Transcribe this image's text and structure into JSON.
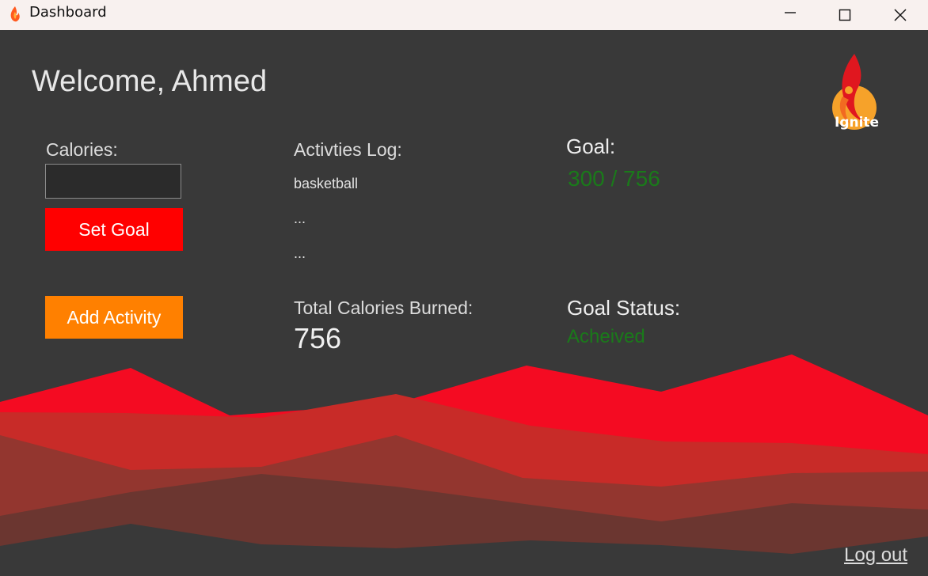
{
  "window": {
    "title": "Dashboard",
    "controls": [
      "minimize-icon",
      "maximize-icon",
      "close-icon"
    ]
  },
  "header": {
    "welcome": "Welcome, Ahmed",
    "logo_text": "Ignite"
  },
  "calories": {
    "label": "Calories:",
    "input_value": "",
    "set_goal_label": "Set Goal",
    "add_activity_label": "Add Activity"
  },
  "activities": {
    "label": "Activties Log:",
    "items": [
      "basketball",
      "...",
      "..."
    ]
  },
  "goal": {
    "label": "Goal:",
    "value": "300 / 756"
  },
  "totals": {
    "label": "Total Calories Burned:",
    "value": "756"
  },
  "goal_status": {
    "label": "Goal Status:",
    "value": "Acheived"
  },
  "footer": {
    "logout_label": "Log out"
  },
  "colors": {
    "background": "#393939",
    "set_goal_button": "#ff0000",
    "add_activity_button": "#ff8000",
    "success_text": "#1a7a1a",
    "wave_bright": "#f40b22",
    "wave_mid": "#c82b28",
    "wave_dark": "#93362f",
    "wave_darkest": "#6b3630"
  }
}
